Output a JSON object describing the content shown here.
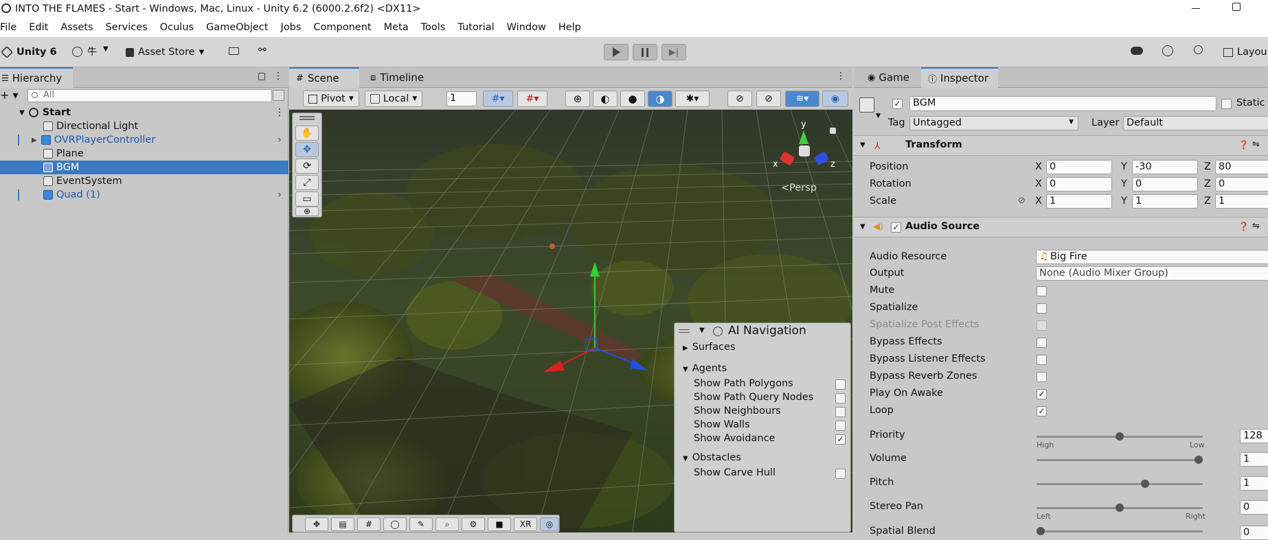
{
  "window_title": "INTO THE FLAMES - Start - Windows, Mac, Linux - Unity 6.2 (6000.2.6f2) <DX11>",
  "menu": [
    "File",
    "Edit",
    "Assets",
    "Services",
    "Oculus",
    "GameObject",
    "Jobs",
    "Component",
    "Meta",
    "Tools",
    "Tutorial",
    "Window",
    "Help"
  ],
  "toolbar": {
    "account_label": "Unity 6",
    "asset_store_label": "Asset Store",
    "layout_label": "Layou"
  },
  "hierarchy": {
    "tab_label": "Hierarchy",
    "search_placeholder": "All",
    "scene_name": "Start",
    "items": [
      {
        "label": "Directional Light"
      },
      {
        "label": "OVRPlayerController"
      },
      {
        "label": "Plane"
      },
      {
        "label": "BGM"
      },
      {
        "label": "EventSystem"
      },
      {
        "label": "Quad (1)"
      }
    ]
  },
  "scene": {
    "tabs": [
      "Scene",
      "Timeline"
    ],
    "pivot_label": "Pivot",
    "local_label": "Local",
    "grid_value": "1",
    "persp_label": "Persp",
    "gizmo_axes": {
      "x": "x",
      "y": "y",
      "z": "z"
    },
    "vr_label": "XR"
  },
  "ai_navigation": {
    "title": "AI Navigation",
    "surfaces": "Surfaces",
    "agents": "Agents",
    "agent_options": [
      {
        "label": "Show Path Polygons",
        "checked": false
      },
      {
        "label": "Show Path Query Nodes",
        "checked": false
      },
      {
        "label": "Show Neighbours",
        "checked": false
      },
      {
        "label": "Show Walls",
        "checked": false
      },
      {
        "label": "Show Avoidance",
        "checked": true
      }
    ],
    "obstacles": "Obstacles",
    "obstacle_option": "Show Carve Hull"
  },
  "inspector": {
    "tabs": [
      "Game",
      "Inspector"
    ],
    "object_name": "BGM",
    "static_label": "Static",
    "tag_label": "Tag",
    "tag_value": "Untagged",
    "layer_label": "Layer",
    "layer_value": "Default",
    "transform": {
      "title": "Transform",
      "position": {
        "label": "Position",
        "x": "0",
        "y": "-30",
        "z": "80"
      },
      "rotation": {
        "label": "Rotation",
        "x": "0",
        "y": "0",
        "z": "0"
      },
      "scale": {
        "label": "Scale",
        "x": "1",
        "y": "1",
        "z": "1"
      },
      "axis_x": "X",
      "axis_y": "Y",
      "axis_z": "Z"
    },
    "audio_source": {
      "title": "Audio Source",
      "audio_resource_label": "Audio Resource",
      "audio_resource_value": "Big Fire",
      "output_label": "Output",
      "output_value": "None (Audio Mixer Group)",
      "checks": [
        {
          "label": "Mute",
          "checked": false,
          "disabled": false
        },
        {
          "label": "Spatialize",
          "checked": false,
          "disabled": false
        },
        {
          "label": "Spatialize Post Effects",
          "checked": false,
          "disabled": true
        },
        {
          "label": "Bypass Effects",
          "checked": false,
          "disabled": false
        },
        {
          "label": "Bypass Listener Effects",
          "checked": false,
          "disabled": false
        },
        {
          "label": "Bypass Reverb Zones",
          "checked": false,
          "disabled": false
        },
        {
          "label": "Play On Awake",
          "checked": true,
          "disabled": false
        },
        {
          "label": "Loop",
          "checked": true,
          "disabled": false
        }
      ],
      "priority": {
        "label": "Priority",
        "value": "128",
        "fraction": 0.5,
        "min_label": "High",
        "max_label": "Low"
      },
      "volume": {
        "label": "Volume",
        "value": "1",
        "fraction": 1.0
      },
      "pitch": {
        "label": "Pitch",
        "value": "1",
        "fraction": 0.66
      },
      "stereo_pan": {
        "label": "Stereo Pan",
        "value": "0",
        "fraction": 0.5,
        "min_label": "Left",
        "max_label": "Right"
      },
      "spatial_blend": {
        "label": "Spatial Blend",
        "value": "0"
      }
    }
  }
}
